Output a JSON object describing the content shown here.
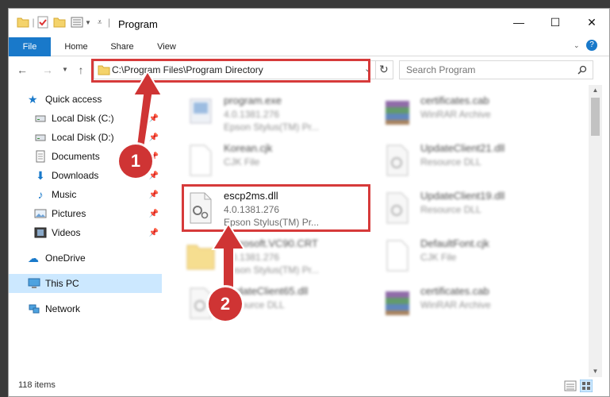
{
  "window": {
    "title": "Program"
  },
  "ribbon": {
    "tabs": [
      "File",
      "Home",
      "Share",
      "View"
    ]
  },
  "address": {
    "path": "C:\\Program Files\\Program Directory"
  },
  "search": {
    "placeholder": "Search Program"
  },
  "sidebar": {
    "items": [
      {
        "label": "Quick access"
      },
      {
        "label": "Local Disk (C:)"
      },
      {
        "label": "Local Disk (D:)"
      },
      {
        "label": "Documents"
      },
      {
        "label": "Downloads"
      },
      {
        "label": "Music"
      },
      {
        "label": "Pictures"
      },
      {
        "label": "Videos"
      },
      {
        "label": "OneDrive"
      },
      {
        "label": "This PC"
      },
      {
        "label": "Network"
      }
    ]
  },
  "files": [
    {
      "name": "program.exe",
      "meta1": "4.0.1381.276",
      "meta2": "Epson Stylus(TM) Pr..."
    },
    {
      "name": "certificates.cab",
      "meta1": "WinRAR Archive",
      "meta2": ""
    },
    {
      "name": "Korean.cjk",
      "meta1": "CJK File",
      "meta2": ""
    },
    {
      "name": "UpdateClient21.dll",
      "meta1": "Resource DLL",
      "meta2": ""
    },
    {
      "name": "escp2ms.dll",
      "meta1": "4.0.1381.276",
      "meta2": "Epson Stylus(TM) Pr..."
    },
    {
      "name": "UpdateClient19.dll",
      "meta1": "Resource DLL",
      "meta2": ""
    },
    {
      "name": "Microsoft.VC90.CRT",
      "meta1": "4.0.1381.276",
      "meta2": "Epson Stylus(TM) Pr..."
    },
    {
      "name": "DefaultFont.cjk",
      "meta1": "CJK File",
      "meta2": ""
    },
    {
      "name": "UpdateClient65.dll",
      "meta1": "Resource DLL",
      "meta2": ""
    },
    {
      "name": "certificates.cab",
      "meta1": "WinRAR Archive",
      "meta2": ""
    }
  ],
  "status": {
    "items": "118 items"
  },
  "callouts": {
    "one": "1",
    "two": "2"
  },
  "colors": {
    "accent": "#1979ca",
    "highlight": "#d63a3a",
    "callout": "#cf3434",
    "selected": "#cce8ff"
  }
}
